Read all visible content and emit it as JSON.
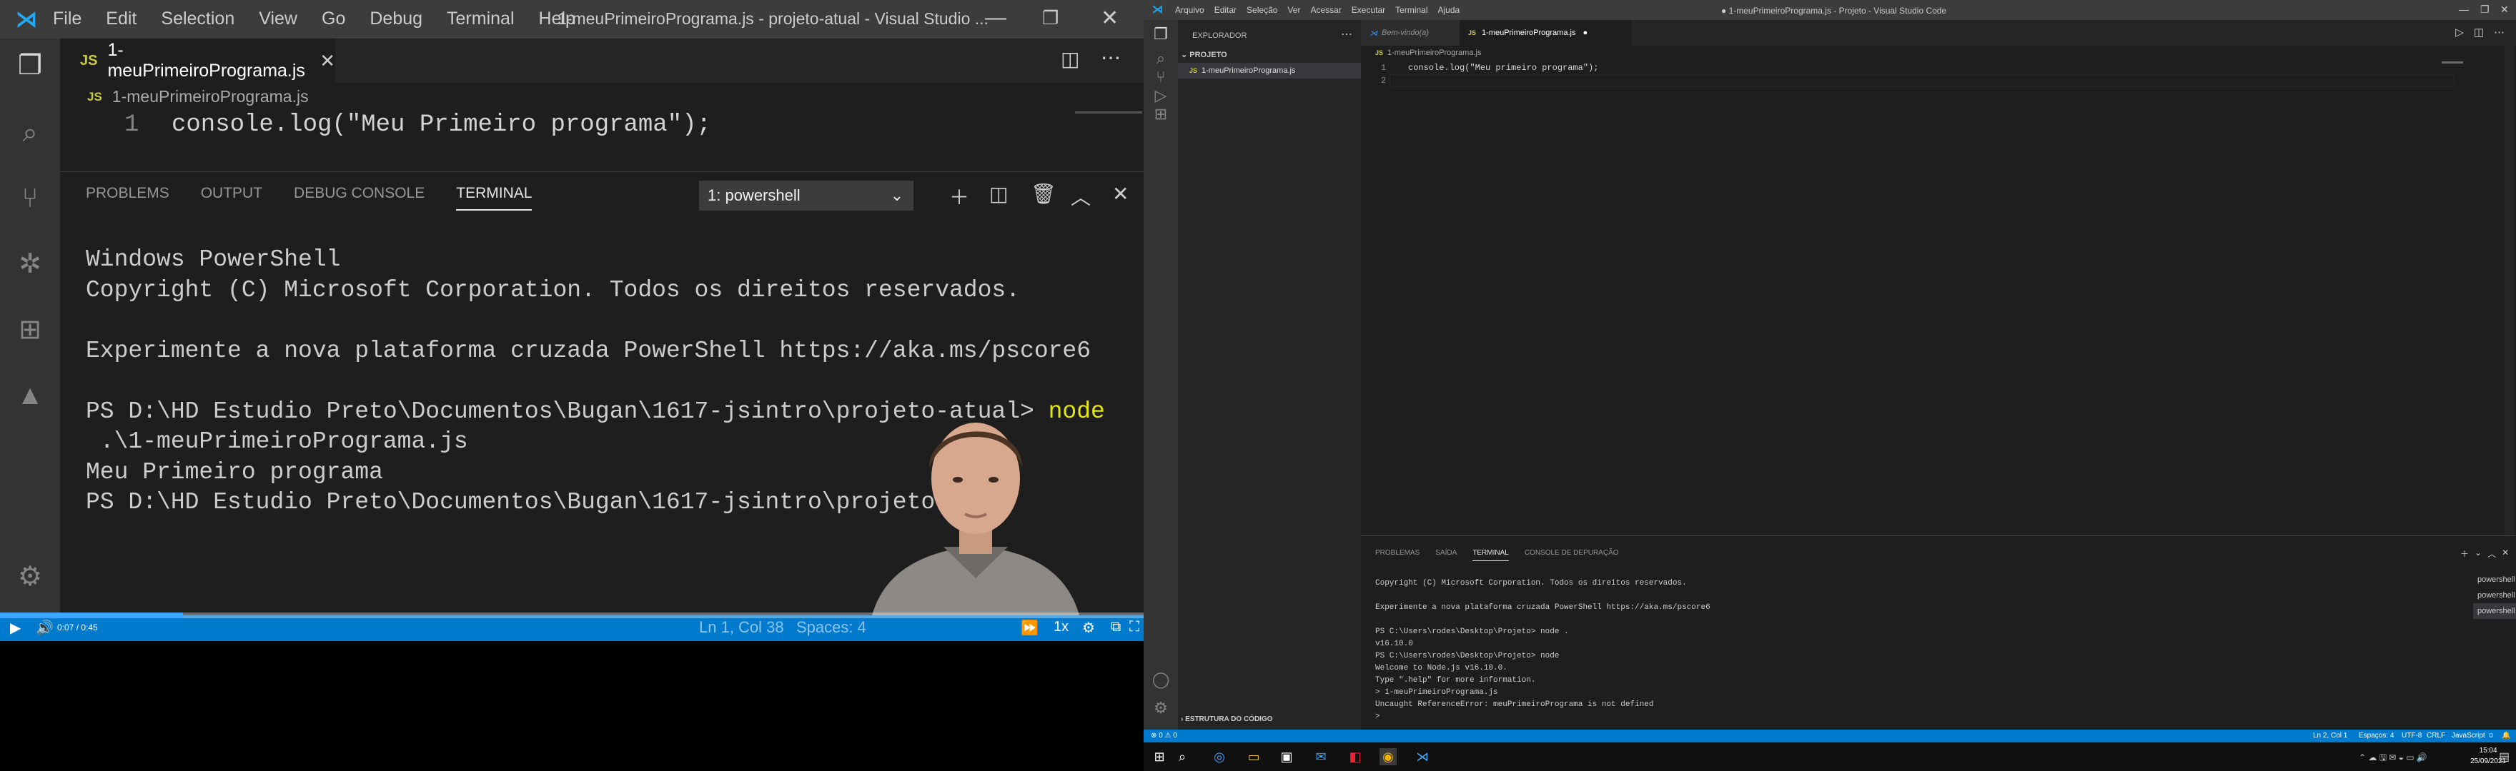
{
  "video": {
    "menu": [
      "File",
      "Edit",
      "Selection",
      "View",
      "Go",
      "Debug",
      "Terminal",
      "Help"
    ],
    "window_title": "1-meuPrimeiroPrograma.js - projeto-atual - Visual Studio ...",
    "tab_label": "1-meuPrimeiroPrograma.js",
    "breadcrumb_file": "1-meuPrimeiroPrograma.js",
    "editor_line_number": "1",
    "editor_code": "console.log(\"Meu Primeiro programa\");",
    "panel_tabs": [
      "PROBLEMS",
      "OUTPUT",
      "DEBUG CONSOLE",
      "TERMINAL"
    ],
    "terminal_select": "1: powershell",
    "terminal_lines": [
      "Windows PowerShell",
      "Copyright (C) Microsoft Corporation. Todos os direitos reservados.",
      "",
      "Experimente a nova plataforma cruzada PowerShell https://aka.ms/pscore6",
      "",
      "PS D:\\HD Estudio Preto\\Documentos\\Bugan\\1617-jsintro\\projeto-atual> ",
      " .\\1-meuPrimeiroPrograma.js",
      "Meu Primeiro programa",
      "PS D:\\HD Estudio Preto\\Documentos\\Bugan\\1617-jsintro\\projeto-atua"
    ],
    "terminal_command": "node",
    "status_position": "Ln 1, Col 38",
    "status_spaces": "Spaces: 4",
    "player_time": "0:07 / 0:45",
    "player_speed": "1x",
    "player_progress": 0.16
  },
  "desktop": {
    "menu": [
      "Arquivo",
      "Editar",
      "Seleção",
      "Ver",
      "Acessar",
      "Executar",
      "Terminal",
      "Ajuda"
    ],
    "window_title": "● 1-meuPrimeiroPrograma.js - Projeto - Visual Studio Code",
    "sidebar_header": "EXPLORADOR",
    "project_name": "PROJETO",
    "file_name": "1-meuPrimeiroPrograma.js",
    "outline_label": "ESTRUTURA DO CÓDIGO",
    "tab_welcome": "Bem-vindo(a)",
    "tab_file": "1-meuPrimeiroPrograma.js",
    "breadcrumb_file": "1-meuPrimeiroPrograma.js",
    "code_lines": [
      {
        "n": "1",
        "text": "console.log(\"Meu primeiro programa\");"
      },
      {
        "n": "2",
        "text": ""
      }
    ],
    "panel_tabs": [
      "PROBLEMAS",
      "SAÍDA",
      "TERMINAL",
      "CONSOLE DE DEPURAÇÃO"
    ],
    "terminal_lines": [
      "Copyright (C) Microsoft Corporation. Todos os direitos reservados.",
      "",
      "Experimente a nova plataforma cruzada PowerShell https://aka.ms/pscore6",
      "",
      "PS C:\\Users\\rodes\\Desktop\\Projeto> node .",
      "v16.10.0",
      "PS C:\\Users\\rodes\\Desktop\\Projeto> node",
      "Welcome to Node.js v16.10.0.",
      "Type \".help\" for more information.",
      "> 1-meuPrimeiroPrograma.js",
      "Uncaught ReferenceError: meuPrimeiroPrograma is not defined",
      "> "
    ],
    "shells": [
      "powershell",
      "powershell",
      "powershell"
    ],
    "status_left": "⊗ 0 ⚠ 0",
    "status_right": [
      "Ln 2, Col 1",
      "Espaços: 4",
      "UTF-8",
      "CRLF",
      "JavaScript"
    ],
    "clock_time": "15:04",
    "clock_date": "25/09/2021"
  },
  "colors": {
    "accent": "#007acc",
    "terminal_highlight": "#e5e510",
    "js_badge": "#cbcb41"
  }
}
